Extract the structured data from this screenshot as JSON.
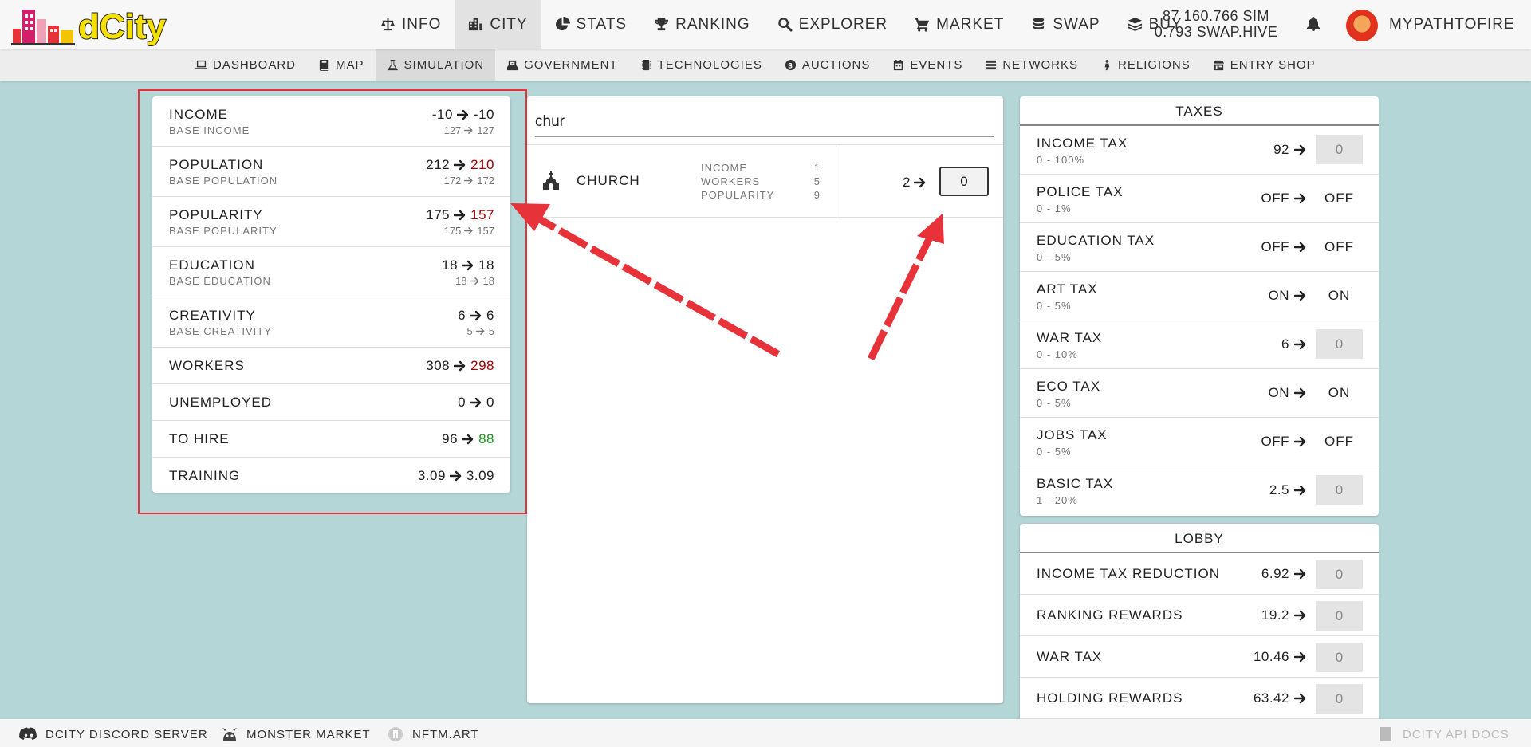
{
  "brand": {
    "logo_text": "dCity"
  },
  "nav_main": [
    {
      "label": "INFO",
      "icon": "balance-scale-icon"
    },
    {
      "label": "CITY",
      "icon": "city-icon",
      "active": true
    },
    {
      "label": "STATS",
      "icon": "pie-chart-icon"
    },
    {
      "label": "RANKING",
      "icon": "trophy-icon"
    },
    {
      "label": "EXPLORER",
      "icon": "search-icon"
    },
    {
      "label": "MARKET",
      "icon": "cart-icon"
    },
    {
      "label": "SWAP",
      "icon": "coins-icon"
    },
    {
      "label": "BUY",
      "icon": "layers-icon"
    }
  ],
  "balance": {
    "sim": "87 160.766 SIM",
    "swap_hive": "0.793 SWAP.HIVE"
  },
  "user": {
    "name": "MYPATHTOFIRE"
  },
  "nav_sub": [
    {
      "label": "DASHBOARD",
      "icon": "laptop-icon"
    },
    {
      "label": "MAP",
      "icon": "book-icon"
    },
    {
      "label": "SIMULATION",
      "icon": "flask-icon",
      "active": true
    },
    {
      "label": "GOVERNMENT",
      "icon": "vote-icon"
    },
    {
      "label": "TECHNOLOGIES",
      "icon": "chip-icon"
    },
    {
      "label": "AUCTIONS",
      "icon": "auction-icon"
    },
    {
      "label": "EVENTS",
      "icon": "calendar-icon"
    },
    {
      "label": "NETWORKS",
      "icon": "network-icon"
    },
    {
      "label": "RELIGIONS",
      "icon": "religion-icon"
    },
    {
      "label": "ENTRY SHOP",
      "icon": "shop-icon"
    }
  ],
  "stats": {
    "income": {
      "label": "INCOME",
      "from": "-10",
      "to": "-10",
      "sub_label": "BASE INCOME",
      "sub_from": "127",
      "sub_to": "127"
    },
    "population": {
      "label": "POPULATION",
      "from": "212",
      "to": "210",
      "sub_label": "BASE POPULATION",
      "sub_from": "172",
      "sub_to": "172"
    },
    "popularity": {
      "label": "POPULARITY",
      "from": "175",
      "to": "157",
      "sub_label": "BASE POPULARITY",
      "sub_from": "175",
      "sub_to": "157"
    },
    "education": {
      "label": "EDUCATION",
      "from": "18",
      "to": "18",
      "sub_label": "BASE EDUCATION",
      "sub_from": "18",
      "sub_to": "18"
    },
    "creativity": {
      "label": "CREATIVITY",
      "from": "6",
      "to": "6",
      "sub_label": "BASE CREATIVITY",
      "sub_from": "5",
      "sub_to": "5"
    },
    "workers": {
      "label": "WORKERS",
      "from": "308",
      "to": "298"
    },
    "unemployed": {
      "label": "UNEMPLOYED",
      "from": "0",
      "to": "0"
    },
    "to_hire": {
      "label": "TO HIRE",
      "from": "96",
      "to": "88"
    },
    "training": {
      "label": "TRAINING",
      "from": "3.09",
      "to": "3.09"
    }
  },
  "search": {
    "value": "chur",
    "placeholder": ""
  },
  "building": {
    "name": "CHURCH",
    "icon": "church-icon",
    "stats": [
      {
        "label": "INCOME",
        "value": "1"
      },
      {
        "label": "WORKERS",
        "value": "5"
      },
      {
        "label": "POPULARITY",
        "value": "9"
      }
    ],
    "count": "2",
    "input_value": "0"
  },
  "taxes": {
    "title": "TAXES",
    "rows": [
      {
        "name": "INCOME TAX",
        "range": "0 - 100%",
        "value": "92",
        "input": "0"
      },
      {
        "name": "POLICE TAX",
        "range": "0 - 1%",
        "value": "OFF",
        "toggle": "OFF"
      },
      {
        "name": "EDUCATION TAX",
        "range": "0 - 5%",
        "value": "OFF",
        "toggle": "OFF"
      },
      {
        "name": "ART TAX",
        "range": "0 - 5%",
        "value": "ON",
        "toggle": "ON"
      },
      {
        "name": "WAR TAX",
        "range": "0 - 10%",
        "value": "6",
        "input": "0"
      },
      {
        "name": "ECO TAX",
        "range": "0 - 5%",
        "value": "ON",
        "toggle": "ON"
      },
      {
        "name": "JOBS TAX",
        "range": "0 - 5%",
        "value": "OFF",
        "toggle": "OFF"
      },
      {
        "name": "BASIC TAX",
        "range": "1 - 20%",
        "value": "2.5",
        "input": "0"
      }
    ]
  },
  "lobby": {
    "title": "LOBBY",
    "rows": [
      {
        "name": "INCOME TAX REDUCTION",
        "value": "6.92",
        "input": "0"
      },
      {
        "name": "RANKING REWARDS",
        "value": "19.2",
        "input": "0"
      },
      {
        "name": "WAR TAX",
        "value": "10.46",
        "input": "0"
      },
      {
        "name": "HOLDING REWARDS",
        "value": "63.42",
        "input": "0"
      }
    ]
  },
  "footer": [
    {
      "label": "DCITY DISCORD SERVER",
      "icon": "discord-icon"
    },
    {
      "label": "MONSTER MARKET",
      "icon": "monster-icon"
    },
    {
      "label": "NFTM.ART",
      "icon": "nftm-icon"
    },
    {
      "label": "DCITY API DOCS",
      "icon": "docs-icon"
    }
  ],
  "colors": {
    "background": "#b4d6d7",
    "negative": "#a40000",
    "positive": "#1a9a1a",
    "annotation": "#e8323a"
  }
}
